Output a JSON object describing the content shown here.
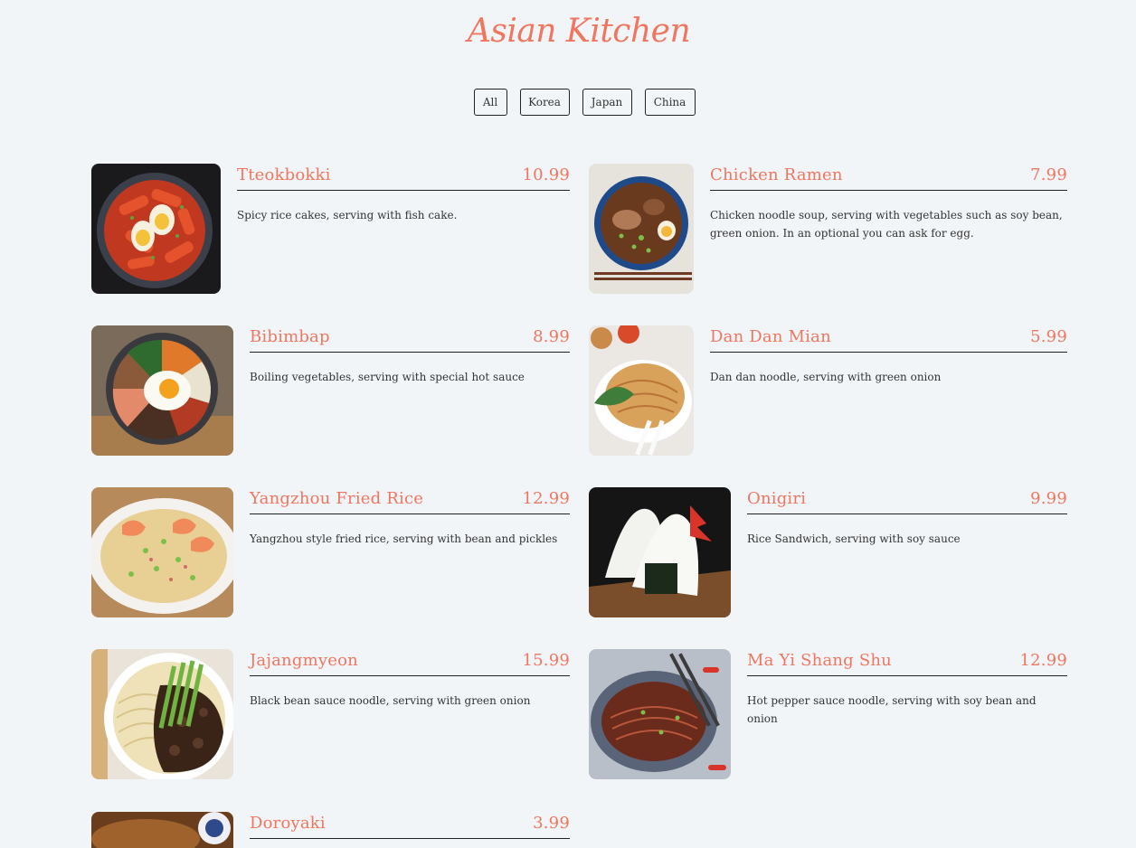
{
  "title": "Asian Kitchen",
  "filters": [
    "All",
    "Korea",
    "Japan",
    "China"
  ],
  "colors": {
    "accent": "#f0765f",
    "background": "#f1f5f8",
    "text": "#333333"
  },
  "items": [
    {
      "name": "Tteokbokki",
      "price": "10.99",
      "desc": "Spicy rice cakes, serving with fish cake."
    },
    {
      "name": "Chicken Ramen",
      "price": "7.99",
      "desc": "Chicken noodle soup, serving with vegetables such as soy bean, green onion. In an optional you can ask for egg."
    },
    {
      "name": "Bibimbap",
      "price": "8.99",
      "desc": "Boiling vegetables, serving with special hot sauce"
    },
    {
      "name": "Dan Dan Mian",
      "price": "5.99",
      "desc": "Dan dan noodle, serving with green onion"
    },
    {
      "name": "Yangzhou Fried Rice",
      "price": "12.99",
      "desc": "Yangzhou style fried rice, serving with bean and pickles"
    },
    {
      "name": "Onigiri",
      "price": "9.99",
      "desc": "Rice Sandwich, serving with soy sauce"
    },
    {
      "name": "Jajangmyeon",
      "price": "15.99",
      "desc": "Black bean sauce noodle, serving with green onion"
    },
    {
      "name": "Ma Yi Shang Shu",
      "price": "12.99",
      "desc": "Hot pepper sauce noodle, serving with soy bean and onion"
    },
    {
      "name": "Doroyaki",
      "price": "3.99",
      "desc": ""
    }
  ]
}
